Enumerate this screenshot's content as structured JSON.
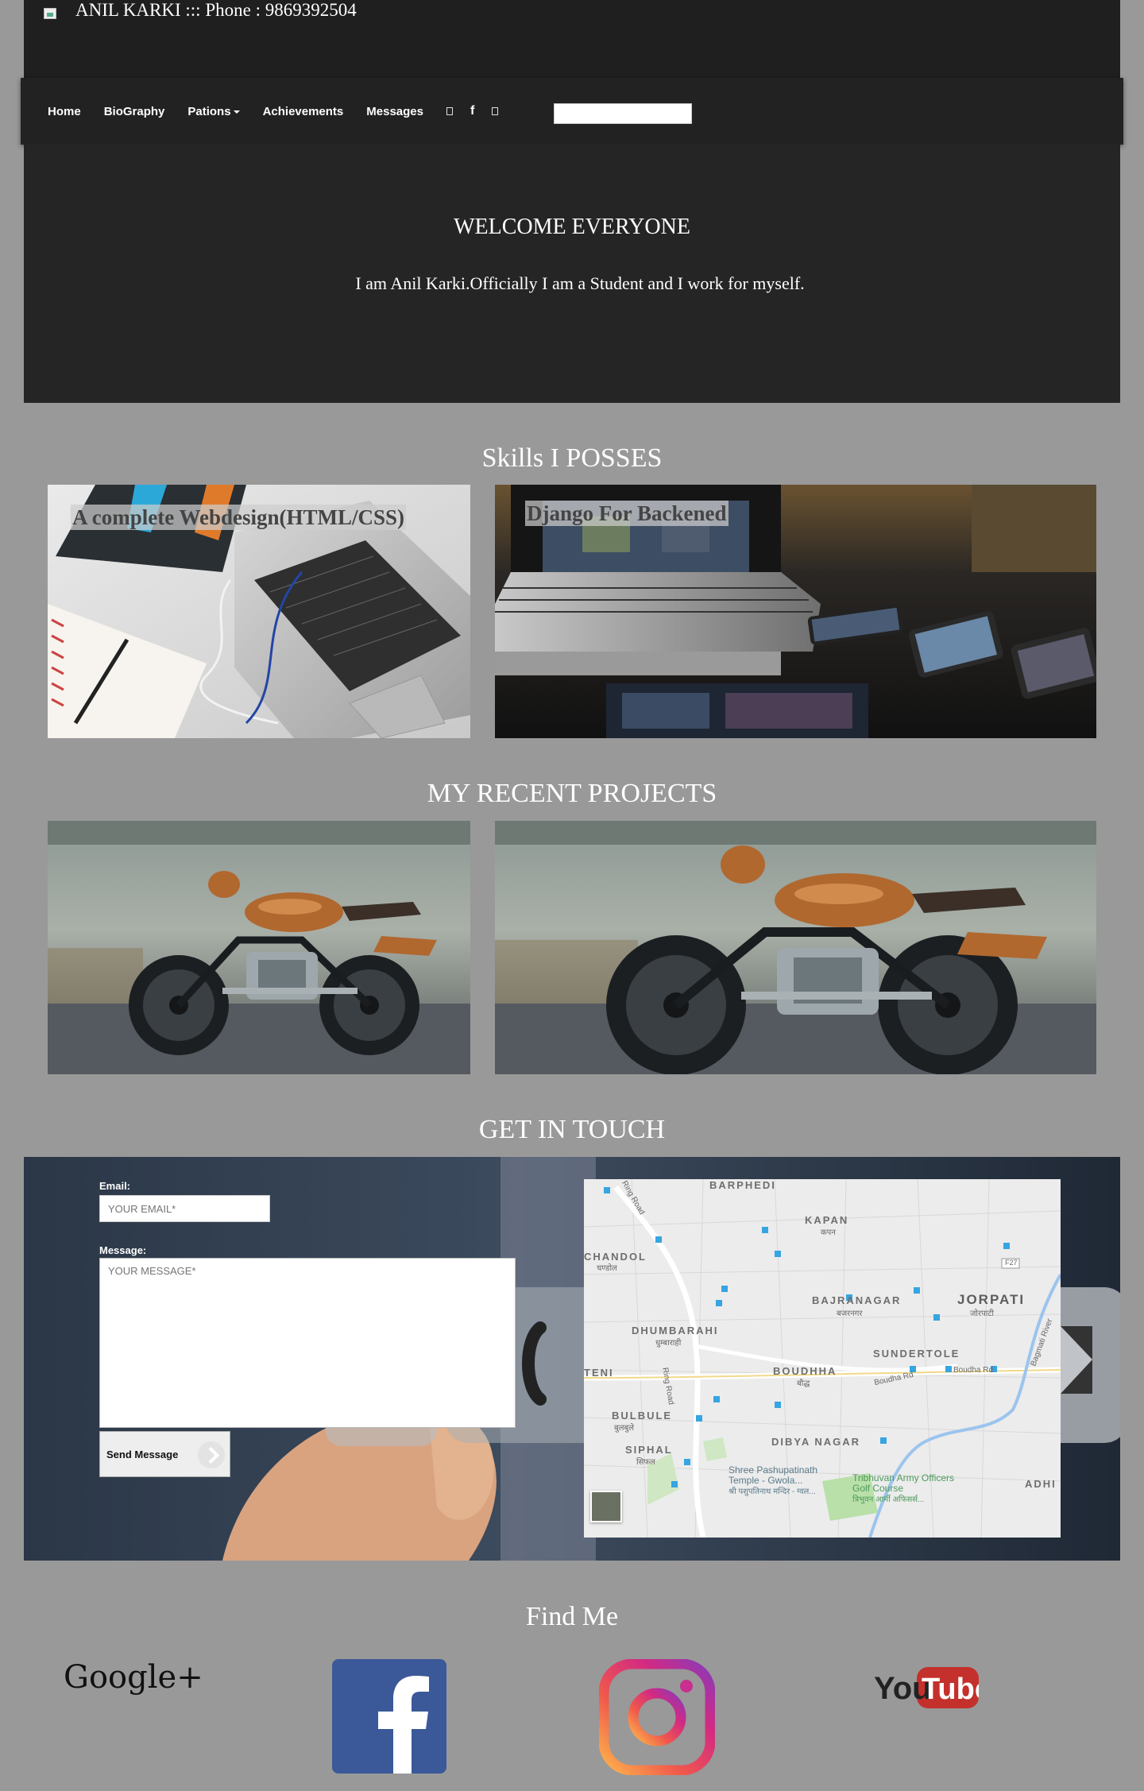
{
  "header": {
    "brand_text": "ANIL KARKI ::: Phone : 9869392504"
  },
  "nav": {
    "items": [
      "Home",
      "BioGraphy",
      "Pations",
      "Achievements",
      "Messages"
    ],
    "icons": [
      "square-icon",
      "facebook-icon",
      "square-icon"
    ],
    "search_value": ""
  },
  "hero": {
    "title": "WELCOME EVERYONE",
    "text": "I am Anil Karki.Officially I am a Student and I work for myself."
  },
  "skills": {
    "title": "Skills I POSSES",
    "cards": [
      {
        "label": "A complete Webdesign(HTML/CSS)"
      },
      {
        "label": "Django For Backened"
      }
    ]
  },
  "projects": {
    "title": "MY RECENT PROJECTS"
  },
  "contact": {
    "title": "GET IN TOUCH",
    "email_label": "Email:",
    "email_placeholder": "YOUR EMAIL*",
    "message_label": "Message:",
    "message_placeholder": "YOUR MESSAGE*",
    "send_label": "Send Message"
  },
  "map": {
    "areas": [
      "BARPHEDI",
      "KAPAN",
      "CHANDOL",
      "BAJRANAGAR",
      "JORPATI",
      "DHUMBARAHI",
      "SUNDERTOLE",
      "TENI",
      "BOUDHHA",
      "BULBULE",
      "DIBYA NAGAR",
      "SIPHAL",
      "ADHI"
    ],
    "areas_local": [
      "कपन",
      "चण्डोल",
      "बजरनगर",
      "जोरपाटी",
      "धुम्बाराही",
      "बौद्ध",
      "बुलबुले",
      "सिफल"
    ],
    "roads": [
      "Ring Road",
      "Ring Road",
      "Boudha Rd",
      "Boudha Rd",
      "Bagmati River",
      "F27"
    ],
    "places": [
      {
        "name": "Shree Pashupatinath Temple - Gwola...",
        "local": "श्री पशुपतिनाथ मन्दिर - ग्वल..."
      },
      {
        "name": "Tribhuvan Army Officers Golf Course",
        "local": "त्रिभुवन आर्मी अफिसर्स..."
      }
    ]
  },
  "find_me": {
    "title": "Find Me",
    "googleplus_label": "Google+",
    "youtube_you": "You",
    "youtube_tube": "Tube"
  },
  "colors": {
    "page_bg": "#999999",
    "header_bg": "#1f1f1f",
    "hero_bg": "#252525",
    "facebook_blue": "#3b5998",
    "youtube_red": "#c4302b"
  }
}
